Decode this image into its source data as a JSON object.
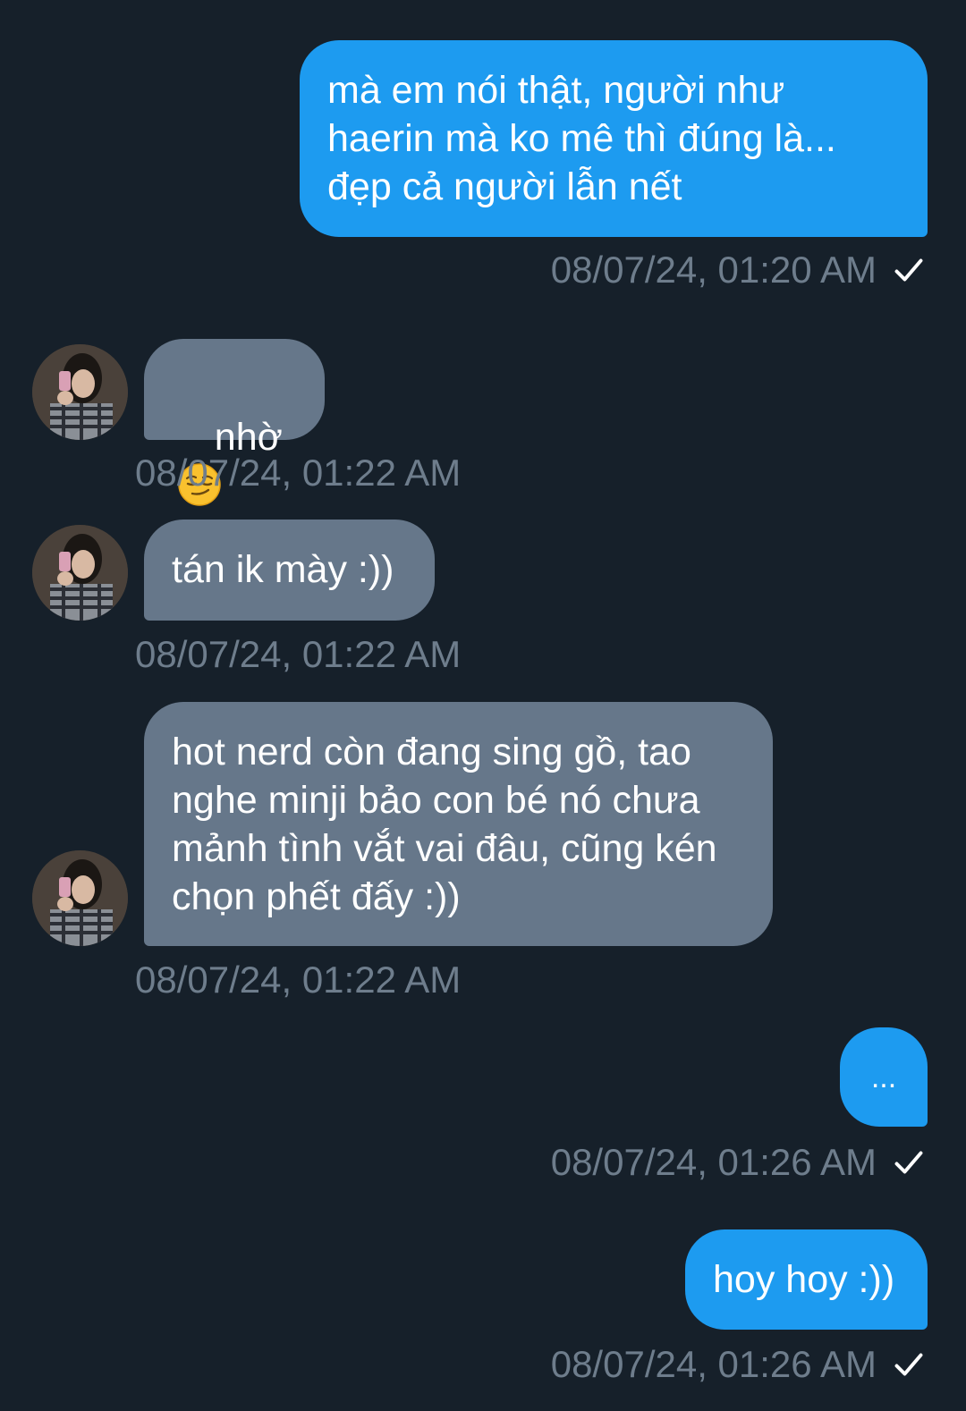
{
  "colors": {
    "background": "#16202a",
    "outgoing_bubble": "#1d9bf0",
    "incoming_bubble": "#66778a",
    "timestamp": "#6e7d8c",
    "text": "#ffffff"
  },
  "messages": [
    {
      "direction": "out",
      "text": "mà em nói thật, người như\nhaerin mà ko mê thì đúng là...\nđẹp cả người lẫn nết",
      "timestamp": "08/07/24, 01:20 AM",
      "read_icon": "check-icon"
    },
    {
      "direction": "in",
      "text": "nhờ",
      "emoji": "smirking-face-emoji",
      "timestamp": "08/07/24, 01:22 AM"
    },
    {
      "direction": "in",
      "text": "tán ik mày :))",
      "timestamp": "08/07/24, 01:22 AM"
    },
    {
      "direction": "in",
      "text": "hot nerd còn đang sing gồ, tao\nnghe minji bảo con bé nó chưa\nmảnh tình vắt vai đâu, cũng kén\nchọn phết đấy :))",
      "timestamp": "08/07/24, 01:22 AM"
    },
    {
      "direction": "out",
      "text": "...",
      "timestamp": "08/07/24, 01:26 AM",
      "read_icon": "check-icon"
    },
    {
      "direction": "out",
      "text": "hoy hoy :))",
      "timestamp": "08/07/24, 01:26 AM",
      "read_icon": "check-icon"
    }
  ]
}
